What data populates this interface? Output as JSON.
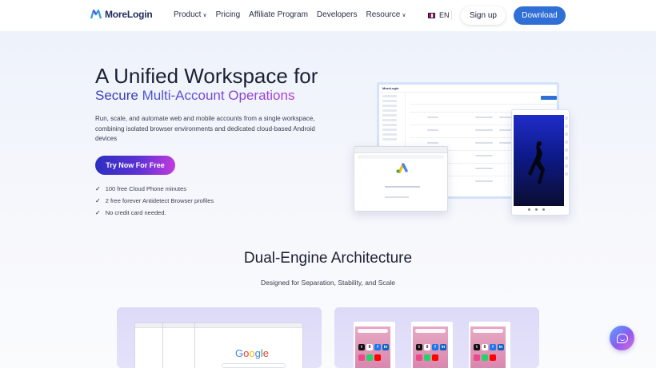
{
  "nav": {
    "brand": "MoreLogin",
    "links": [
      {
        "label": "Product",
        "has_menu": true
      },
      {
        "label": "Pricing",
        "has_menu": false
      },
      {
        "label": "Affiliate Program",
        "has_menu": false
      },
      {
        "label": "Developers",
        "has_menu": false
      },
      {
        "label": "Resource",
        "has_menu": true
      }
    ],
    "language": "EN",
    "signup_label": "Sign up",
    "download_label": "Download"
  },
  "hero": {
    "title": "A Unified Workspace for",
    "subtitle_prefix": "Secure ",
    "subtitle_highlight": "Multi-Account Operations",
    "description": "Run, scale, and automate web and mobile accounts from a single workspace, combining isolated browser environments and dedicated cloud-based Android devices",
    "cta_label": "Try Now For Free",
    "features": [
      "100 free Cloud Phone minutes",
      "2 free forever Antidetect Browser profiles",
      "No credit card needed."
    ],
    "mock_brand": "MoreLogin"
  },
  "section": {
    "title": "Dual-Engine Architecture",
    "subtitle": "Designed for Separation, Stability, and Scale",
    "google_logo": "Google"
  },
  "colors": {
    "accent": "#2f6fd6",
    "cta_start": "#2c2fc0",
    "cta_end": "#c23bdc",
    "brand_text": "#1e2a5a"
  },
  "icons": {
    "logo": "morelogin-logo-icon",
    "chat": "chat-widget-icon",
    "flag": "uk-flag-icon"
  }
}
